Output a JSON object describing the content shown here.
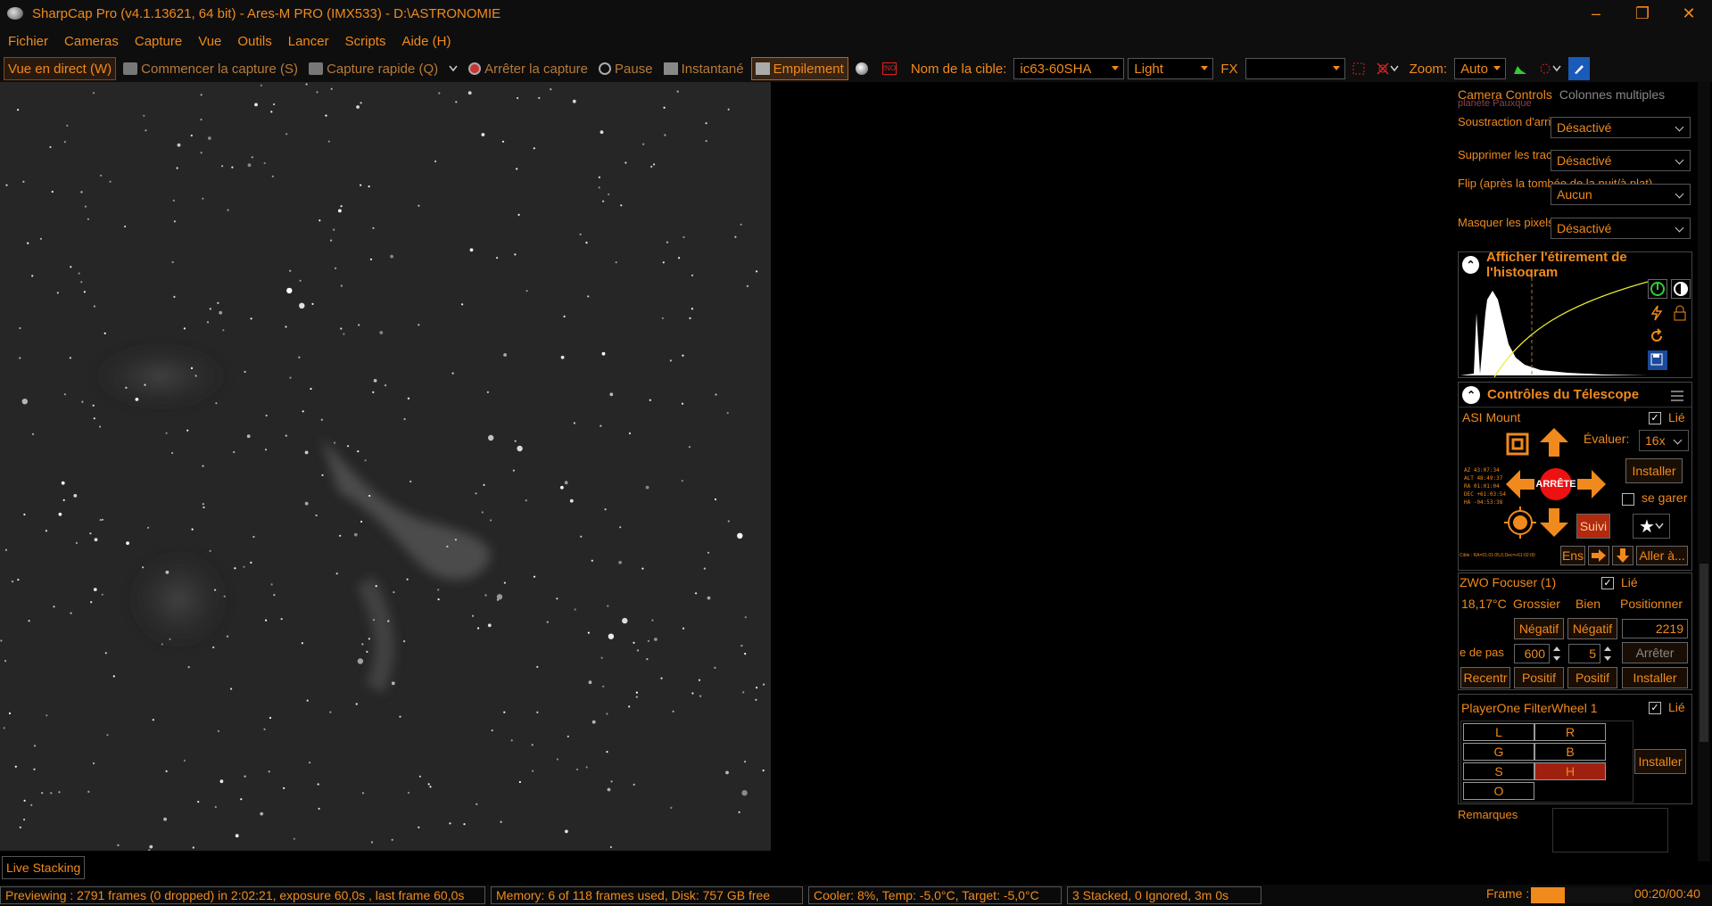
{
  "titlebar": {
    "title": "SharpCap Pro (v4.1.13621, 64 bit) - Ares-M PRO (IMX533) - D:\\ASTRONOMIE",
    "minimize": "–",
    "restore": "❐",
    "close": "✕"
  },
  "menu": [
    "Fichier",
    "Cameras",
    "Capture",
    "Vue",
    "Outils",
    "Lancer",
    "Scripts",
    "Aide (H)"
  ],
  "toolbar": {
    "live_view": "Vue en direct (W)",
    "start_capture": "Commencer la capture (S)",
    "quick_capture": "Capture rapide (Q)",
    "stop_capture": "Arrêter la capture",
    "pause": "Pause",
    "snapshot": "Instantané",
    "stacking": "Empilement",
    "target_label": "Nom de la cible:",
    "target_value": "ic63-60SHA",
    "frame_type": "Light",
    "fx_label": "FX",
    "fx_value": "",
    "zoom_label": "Zoom:",
    "zoom_value": "Auto",
    "red_icon_text": "!NO"
  },
  "camera_panel": {
    "tab_camera": "Camera Controls",
    "tab_multi": "Colonnes multiples",
    "partial_label": "planète Pauxque",
    "settings": [
      {
        "label": "Soustraction d'arrière-plan",
        "value": "Désactivé"
      },
      {
        "label": "Supprimer les traces satellites",
        "value": "Désactivé"
      },
      {
        "label": "Flip (après la tombée de la nuit/à plat)",
        "value": "Aucun"
      },
      {
        "label": "Masquer les pixels exposés",
        "value": "Désactivé"
      }
    ]
  },
  "histogram": {
    "title": "Afficher l'étirement de l'histogram"
  },
  "telescope": {
    "title": "Contrôles du Télescope",
    "mount_name": "ASI Mount",
    "linked_label": "Lié",
    "rate_label": "Évaluer:",
    "rate_value": "16x",
    "install_label": "Installer",
    "park_label": "se garer",
    "stop_label": "ARRÊTE",
    "track_label": "Suivi",
    "ens_label": "Ens",
    "goto_label": "Aller à...",
    "coords": [
      "AZ  43:07:34",
      "ALT  48:49:37",
      "RA  01:01:04",
      "DEC  +61:03:54",
      "HA  -04:53:38"
    ],
    "target_line": "Cible : RA=01:01:05,0,Dec=+61:02:00"
  },
  "focuser": {
    "name": "ZWO Focuser (1)",
    "linked_label": "Lié",
    "temp": "18,17°C",
    "coarse_label": "Grossier",
    "fine_label": "Bien",
    "position_label": "Positionner",
    "negative_label": "Négatif",
    "positive_label": "Positif",
    "position_value": "2219",
    "step_label": "e de pas",
    "coarse_step": "600",
    "fine_step": "5",
    "stop_label": "Arrêter",
    "recenter_label": "Recentr",
    "install_label": "Installer"
  },
  "filterwheel": {
    "name": "PlayerOne FilterWheel 1",
    "linked_label": "Lié",
    "filters": [
      "L",
      "R",
      "G",
      "B",
      "S",
      "H",
      "O"
    ],
    "selected": "H",
    "install_label": "Installer"
  },
  "notes": {
    "label": "Remarques"
  },
  "bottom": {
    "tab": "Live Stacking",
    "status_preview": "Previewing : 2791 frames (0 dropped) in 2:02:21, exposure 60,0s , last frame 60,0s",
    "status_memory": "Memory: 6 of 118 frames used, Disk: 757 GB free",
    "status_cooler": "Cooler: 8%, Temp: -5,0°C, Target: -5,0°C",
    "status_stack": "3 Stacked, 0 Ignored, 3m 0s",
    "frame_label": "Frame :",
    "frame_progress": 0.33,
    "frame_time": "00:20/00:40"
  },
  "colors": {
    "accent": "#f08a1c",
    "bg": "#000000",
    "selected": "#a02010"
  }
}
